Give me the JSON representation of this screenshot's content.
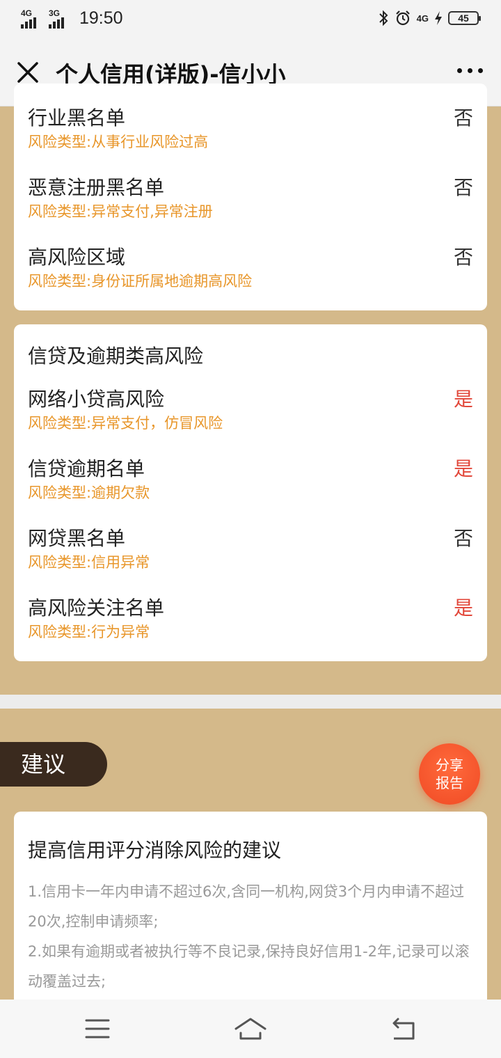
{
  "status_bar": {
    "sim1": "4G",
    "sim2": "3G",
    "time": "19:50",
    "net_right": "4G",
    "battery": "45"
  },
  "title_bar": {
    "title": "个人信用(详版)-信小小"
  },
  "card1": {
    "rows": [
      {
        "name": "行业黑名单",
        "value": "否",
        "risk": "风险类型:从事行业风险过高"
      },
      {
        "name": "恶意注册黑名单",
        "value": "否",
        "risk": "风险类型:异常支付,异常注册"
      },
      {
        "name": "高风险区域",
        "value": "否",
        "risk": "风险类型:身份证所属地逾期高风险"
      }
    ]
  },
  "card2": {
    "heading": "信贷及逾期类高风险",
    "rows": [
      {
        "name": "网络小贷高风险",
        "value": "是",
        "risk": "风险类型:异常支付，仿冒风险"
      },
      {
        "name": "信贷逾期名单",
        "value": "是",
        "risk": "风险类型:逾期欠款"
      },
      {
        "name": "网贷黑名单",
        "value": "否",
        "risk": "风险类型:信用异常"
      },
      {
        "name": "高风险关注名单",
        "value": "是",
        "risk": "风险类型:行为异常"
      }
    ]
  },
  "advice": {
    "tab_label": "建议",
    "share_line1": "分享",
    "share_line2": "报告",
    "title": "提高信用评分消除风险的建议",
    "item1": "1.信用卡一年内申请不超过6次,含同一机构,网贷3个月内申请不超过20次,控制申请频率;",
    "item2": "2.如果有逾期或者被执行等不良记录,保持良好信用1-2年,记录可以滚动覆盖过去;"
  },
  "colors": {
    "background": "#d4b98a",
    "risk_text": "#e8962a",
    "yes_text": "#e2473a",
    "tab_bg": "#3a2a1e",
    "share_bg": "#f04a24"
  }
}
